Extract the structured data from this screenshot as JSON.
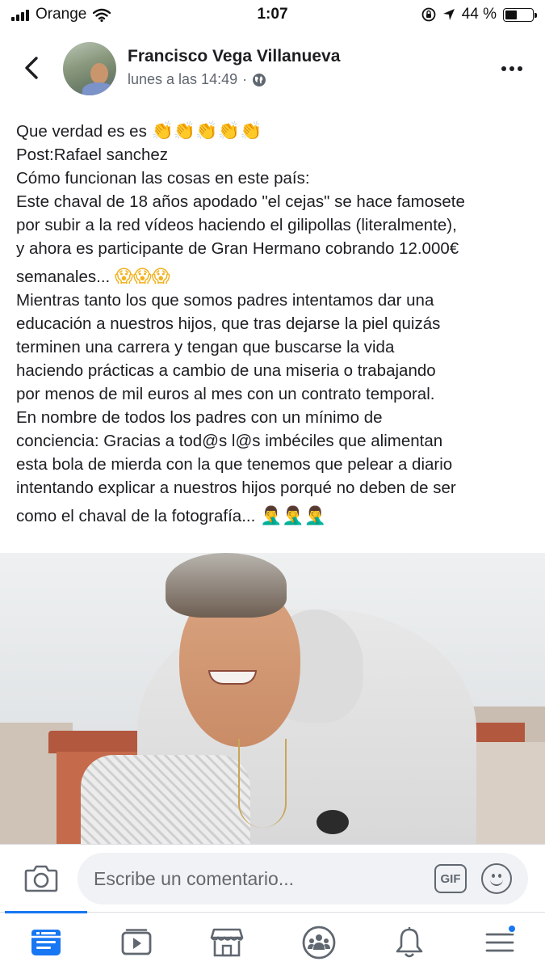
{
  "status_bar": {
    "carrier": "Orange",
    "time": "1:07",
    "battery_percent": "44 %",
    "battery_level": 0.44
  },
  "post": {
    "author": "Francisco Vega Villanueva",
    "timestamp": "lunes a las 14:49",
    "separator": "·",
    "privacy_icon": "globe-icon",
    "text_lines": [
      "Que verdad es es",
      "Post:Rafael sanchez",
      "Cómo funcionan las cosas en este país:",
      "Este chaval de 18 años apodado \"el cejas\" se hace famosete",
      "por subir a la red vídeos haciendo el gilipollas (literalmente),",
      "y ahora es participante de Gran Hermano cobrando 12.000€",
      "semanales...",
      "Mientras tanto los que somos padres intentamos dar una",
      "educación a nuestros hijos, que tras dejarse la piel quizás",
      "terminen una carrera y tengan que buscarse la vida",
      "haciendo prácticas a cambio de una miseria o trabajando",
      "por menos de mil euros al mes con un contrato temporal.",
      "En nombre de todos los padres con un mínimo de",
      "conciencia: Gracias a tod@s l@s imbéciles que alimentan",
      "esta bola de mierda con la que tenemos que pelear a diario",
      "intentando explicar a nuestros hijos porqué no deben de ser",
      "como el chaval de la fotografía..."
    ],
    "emoji": {
      "clapping": "👏👏👏👏👏",
      "scream": "😱😱😱",
      "facepalm": "🤦‍♂️🤦‍♂️🤦‍♂️"
    }
  },
  "comment_bar": {
    "placeholder": "Escribe un comentario...",
    "gif_label": "GIF"
  },
  "tabs": [
    {
      "name": "news-feed",
      "icon": "news-feed-icon",
      "active": true
    },
    {
      "name": "watch",
      "icon": "video-icon",
      "active": false
    },
    {
      "name": "marketplace",
      "icon": "marketplace-icon",
      "active": false
    },
    {
      "name": "groups",
      "icon": "groups-icon",
      "active": false
    },
    {
      "name": "notifications",
      "icon": "bell-icon",
      "active": false,
      "badge": true
    },
    {
      "name": "menu",
      "icon": "menu-icon",
      "active": false
    }
  ],
  "colors": {
    "accent": "#1877f2",
    "text": "#1c1e21",
    "secondary_text": "#606770",
    "input_background": "#f0f2f5"
  }
}
